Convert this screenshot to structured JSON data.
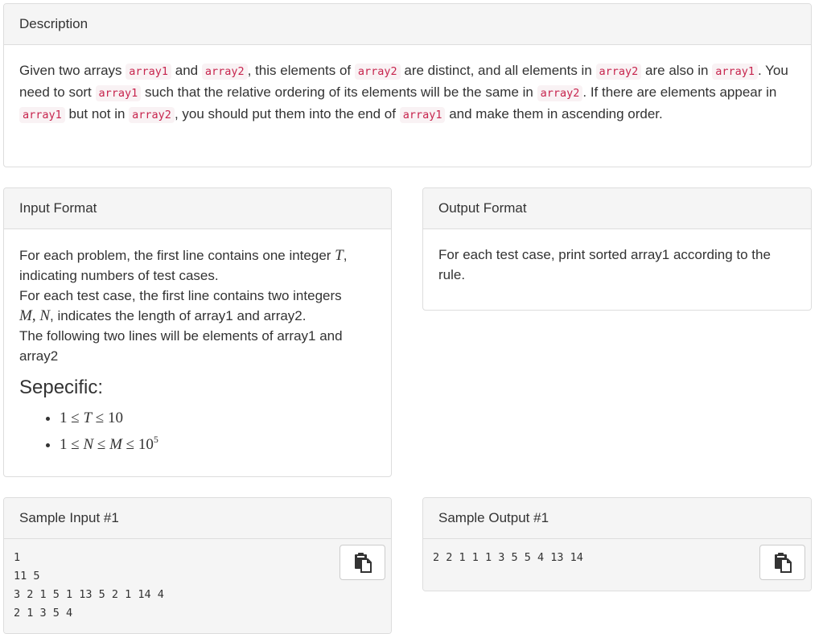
{
  "description": {
    "heading": "Description",
    "parts": [
      {
        "t": "text",
        "v": "Given two arrays "
      },
      {
        "t": "code",
        "v": "array1"
      },
      {
        "t": "text",
        "v": " and "
      },
      {
        "t": "code",
        "v": "array2"
      },
      {
        "t": "text",
        "v": ", this elements of "
      },
      {
        "t": "code",
        "v": "array2"
      },
      {
        "t": "text",
        "v": " are distinct, and all elements in "
      },
      {
        "t": "code",
        "v": "array2"
      },
      {
        "t": "text",
        "v": " are also in "
      },
      {
        "t": "code",
        "v": "array1"
      },
      {
        "t": "text",
        "v": ". You need to sort "
      },
      {
        "t": "code",
        "v": "array1"
      },
      {
        "t": "text",
        "v": " such that the relative ordering of its elements will be the same in "
      },
      {
        "t": "code",
        "v": "array2"
      },
      {
        "t": "text",
        "v": ". If there are elements appear in "
      },
      {
        "t": "code",
        "v": "array1"
      },
      {
        "t": "text",
        "v": " but not in "
      },
      {
        "t": "code",
        "v": "array2"
      },
      {
        "t": "text",
        "v": ", you should put them into the end of "
      },
      {
        "t": "code",
        "v": "array1"
      },
      {
        "t": "text",
        "v": " and make them in ascending order."
      }
    ]
  },
  "input_format": {
    "heading": "Input Format",
    "line1_pre": "For each problem, the first line contains one integer ",
    "line1_var": "T",
    "line1_post": ", indicating numbers of test cases.",
    "line2_pre": "For each test case, the first line contains two integers",
    "line2_var_m": "M",
    "line2_comma": ", ",
    "line2_var_n": "N",
    "line2_post": ", indicates the length of array1 and array2.",
    "line3": "The following two lines will be elements of array1 and array2",
    "specific_heading": "Sepecific:",
    "constraint1": {
      "a": "1 ≤ ",
      "v": "T",
      "b": " ≤ 10"
    },
    "constraint2": {
      "a": "1 ≤ ",
      "v1": "N",
      "mid": " ≤ ",
      "v2": "M",
      "b": " ≤ 10",
      "exp": "5"
    }
  },
  "output_format": {
    "heading": "Output Format",
    "text": "For each test case, print sorted array1 according to the rule."
  },
  "sample_input": {
    "heading": "Sample Input #1",
    "content": "1\n11 5\n3 2 1 5 1 13 5 2 1 14 4\n2 1 3 5 4"
  },
  "sample_output": {
    "heading": "Sample Output #1",
    "content": "2 2 1 1 1 3 5 5 4 13 14"
  },
  "icons": {
    "copy": "clipboard-copy-icon"
  }
}
